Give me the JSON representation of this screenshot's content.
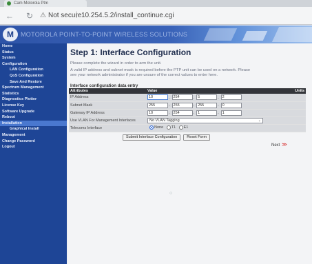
{
  "browser": {
    "tab_title": "Cam Motorola Ptm",
    "security_label": "Not secure",
    "url": "10.254.5.2/install_continue.cgi",
    "url_separator": "|"
  },
  "banner": {
    "logo": "M",
    "title": "MOTOROLA POINT-TO-POINT WIRELESS SOLUTIONS"
  },
  "sidebar": {
    "items": [
      {
        "label": "Home",
        "level": 0
      },
      {
        "label": "Status",
        "level": 0
      },
      {
        "label": "System",
        "level": 0
      },
      {
        "label": "Configuration",
        "level": 0
      },
      {
        "label": "LAN Configuration",
        "level": 1
      },
      {
        "label": "QoS Configuration",
        "level": 1
      },
      {
        "label": "Save And Restore",
        "level": 1
      },
      {
        "label": "Spectrum Management",
        "level": 0
      },
      {
        "label": "Statistics",
        "level": 0
      },
      {
        "label": "Diagnostics Plotter",
        "level": 0
      },
      {
        "label": "License Key",
        "level": 0
      },
      {
        "label": "Software Upgrade",
        "level": 0
      },
      {
        "label": "Reboot",
        "level": 0
      },
      {
        "label": "Installation",
        "level": 0,
        "active": true
      },
      {
        "label": "Graphical Install",
        "level": 1
      },
      {
        "label": "Management",
        "level": 0
      },
      {
        "label": "Change Password",
        "level": 0
      },
      {
        "label": "Logout",
        "level": 0
      }
    ]
  },
  "main": {
    "title": "Step 1: Interface Configuration",
    "intro": "Please complete the wizard in order to arm the unit.",
    "info_line1": "A valid IP address and subnet mask is required before the PTP unit can be used on a network. Please",
    "info_line2": "see your network administrator if you are unsure of the correct values to enter here.",
    "section_title": "Interface configuration data entry",
    "table": {
      "headers": [
        "Attributes",
        "Value",
        "Units"
      ],
      "ip_label": "IP Address",
      "ip": [
        "10",
        "254",
        "5",
        "2"
      ],
      "mask_label": "Subnet Mask",
      "mask": [
        "255",
        "255",
        "255",
        "0"
      ],
      "gw_label": "Gateway IP Address",
      "gw": [
        "10",
        "254",
        "1",
        "1"
      ],
      "vlan_label": "Use VLAN For Management Interfaces",
      "vlan_value": "No VLAN Tagging",
      "telecom_label": "Telecoms Interface",
      "telecom_options": [
        "None",
        "T1",
        "E1"
      ]
    },
    "buttons": {
      "submit": "Submit Interface Configuration",
      "reset": "Reset Form"
    },
    "next_label": "Next",
    "next_arrows": ">>"
  }
}
